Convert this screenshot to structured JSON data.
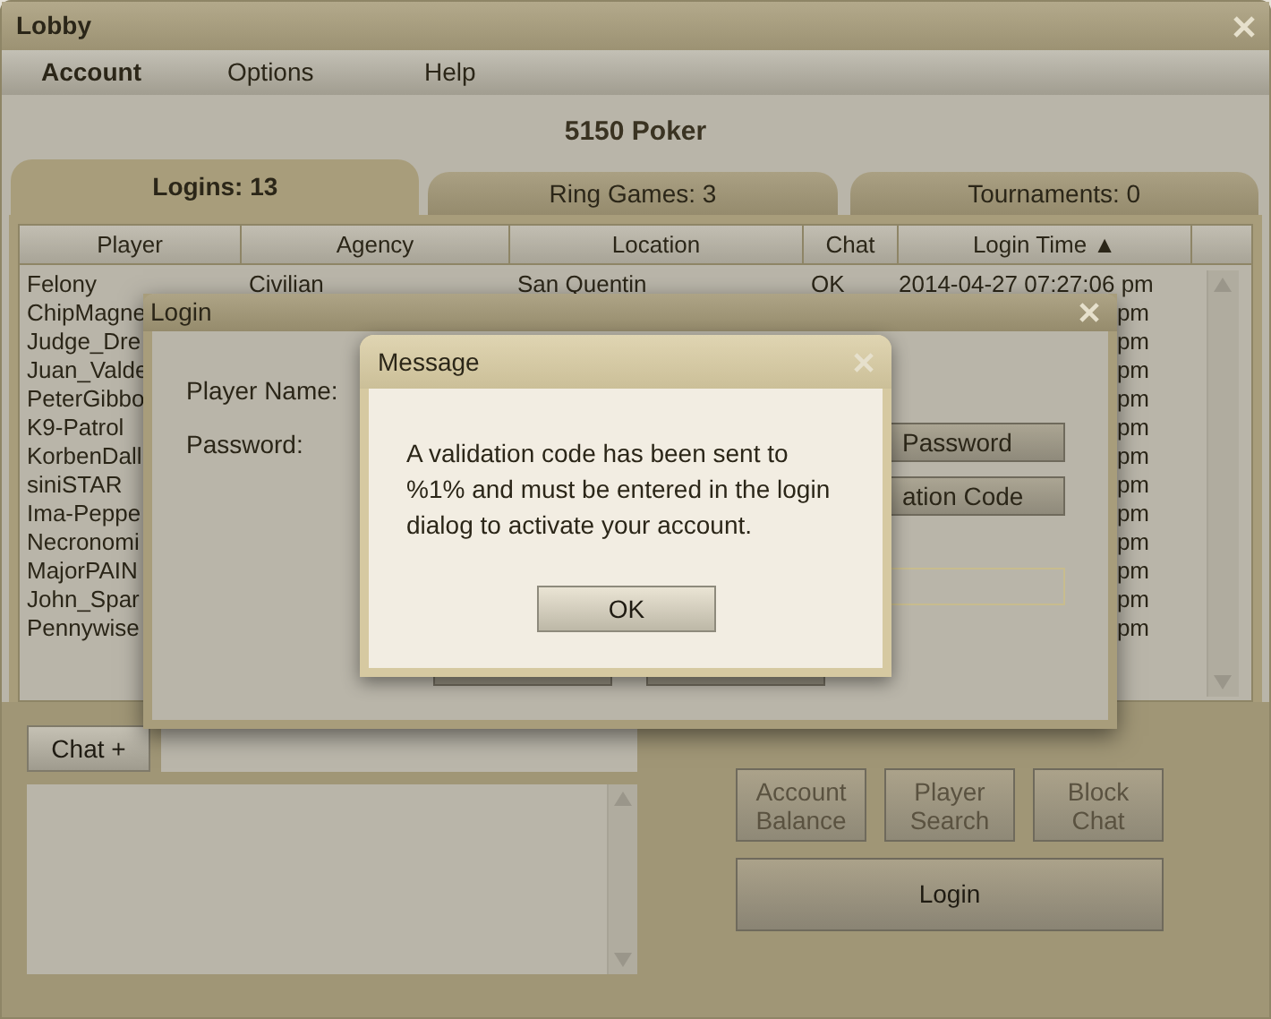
{
  "window": {
    "title": "Lobby"
  },
  "menu": [
    {
      "label": "Account",
      "selected": true
    },
    {
      "label": "Options",
      "selected": false
    },
    {
      "label": "Help",
      "selected": false
    }
  ],
  "heading": "5150 Poker",
  "tabs": [
    {
      "label": "Logins: 13",
      "selected": true
    },
    {
      "label": "Ring Games: 3",
      "selected": false
    },
    {
      "label": "Tournaments: 0",
      "selected": false
    }
  ],
  "table": {
    "columns": [
      "Player",
      "Agency",
      "Location",
      "Chat",
      "Login Time ▲"
    ],
    "rows": [
      {
        "player": "Felony",
        "agency": "Civilian",
        "location": "San Quentin",
        "chat": "OK",
        "login_time": "2014-04-27 07:27:06 pm"
      },
      {
        "player": "ChipMagne",
        "login_time": "pm"
      },
      {
        "player": "Judge_Dre",
        "login_time": "pm"
      },
      {
        "player": "Juan_Valde",
        "login_time": "pm"
      },
      {
        "player": "PeterGibbo",
        "login_time": "pm"
      },
      {
        "player": "K9-Patrol",
        "login_time": "pm"
      },
      {
        "player": "KorbenDall",
        "login_time": "pm"
      },
      {
        "player": "siniSTAR",
        "login_time": "pm"
      },
      {
        "player": "Ima-Peppe",
        "login_time": "pm"
      },
      {
        "player": "Necronomi",
        "login_time": "pm"
      },
      {
        "player": "MajorPAIN",
        "login_time": "pm"
      },
      {
        "player": "John_Spar",
        "login_time": "pm"
      },
      {
        "player": "Pennywise",
        "login_time": "pm"
      }
    ]
  },
  "chat": {
    "button": "Chat +"
  },
  "actions": [
    "Account Balance",
    "Player Search",
    "Block Chat"
  ],
  "login_button": "Login",
  "login_dialog": {
    "title": "Login",
    "labels": [
      "Player Name:",
      "Password:"
    ],
    "buttons": [
      "Password",
      "ation Code"
    ]
  },
  "message": {
    "title": "Message",
    "text": "A validation code has been sent to %1% and must be entered in the login dialog to activate your account.",
    "button": "OK"
  }
}
